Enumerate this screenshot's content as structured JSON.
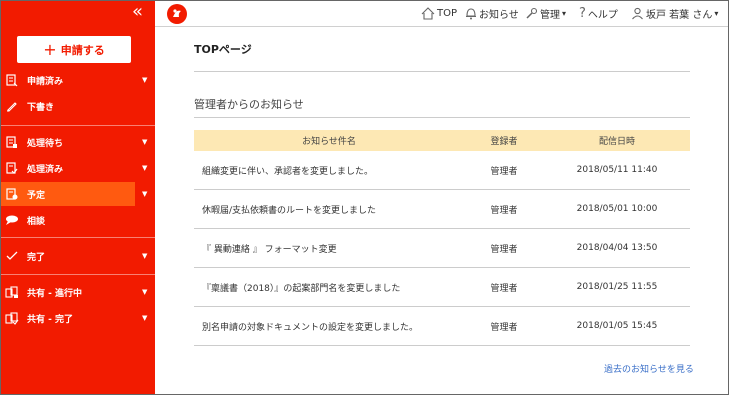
{
  "sidebar": {
    "new_button": "申請する",
    "items": [
      {
        "label": "申請済み",
        "arrow": "▼"
      },
      {
        "label": "下書き",
        "arrow": ""
      },
      {
        "label": "処理待ち",
        "arrow": "▼"
      },
      {
        "label": "処理済み",
        "arrow": "▼"
      },
      {
        "label": "予定",
        "arrow": "▼"
      },
      {
        "label": "相談",
        "arrow": ""
      },
      {
        "label": "完了",
        "arrow": "▼"
      },
      {
        "label": "共有 - 進行中",
        "arrow": "▼"
      },
      {
        "label": "共有 - 完了",
        "arrow": "▼"
      }
    ]
  },
  "topbar": {
    "top": "TOP",
    "notice": "お知らせ",
    "admin": "管理",
    "help": "ヘルプ",
    "user": "坂戸 若葉 さん",
    "caret": "▾"
  },
  "main": {
    "page_title": "TOPページ",
    "section_title": "管理者からのお知らせ",
    "columns": [
      "お知らせ件名",
      "登録者",
      "配信日時"
    ],
    "rows": [
      {
        "subject": "組織変更に伴い、承認者を変更しました。",
        "author": "管理者",
        "date": "2018/05/11 11:40"
      },
      {
        "subject": "休暇届/支払依頼書のルートを変更しました",
        "author": "管理者",
        "date": "2018/05/01 10:00"
      },
      {
        "subject": "『 異動連絡 』 フォーマット変更",
        "author": "管理者",
        "date": "2018/04/04 13:50"
      },
      {
        "subject": "『稟議書（2018）』の起案部門名を変更しました",
        "author": "管理者",
        "date": "2018/01/25 11:55"
      },
      {
        "subject": "別名申請の対象ドキュメントの設定を変更しました。",
        "author": "管理者",
        "date": "2018/01/05 15:45"
      }
    ],
    "more_link": "過去のお知らせを見る"
  },
  "colors": {
    "sidebar": "#f21b00",
    "active": "#ff5a10",
    "table_header": "#fde8b4",
    "link": "#3a6fc8"
  }
}
